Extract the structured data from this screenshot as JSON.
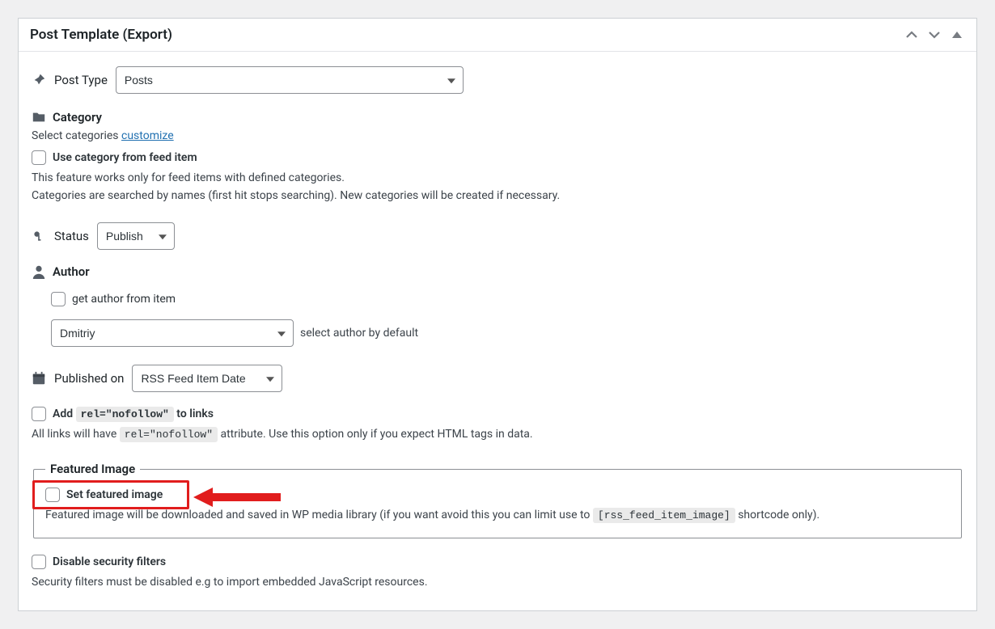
{
  "panel": {
    "title": "Post Template (Export)"
  },
  "post_type": {
    "label": "Post Type",
    "value": "Posts"
  },
  "category": {
    "heading": "Category",
    "prefix": "Select categories ",
    "customize_link": "customize",
    "use_from_feed_label": "Use category from feed item",
    "help1": "This feature works only for feed items with defined categories.",
    "help2": "Categories are searched by names (first hit stops searching). New categories will be created if necessary."
  },
  "status": {
    "label": "Status",
    "value": "Publish"
  },
  "author": {
    "heading": "Author",
    "get_from_item_label": "get author from item",
    "value": "Dmitriy",
    "select_default_label": "select author by default"
  },
  "published_on": {
    "label": "Published on",
    "value": "RSS Feed Item Date"
  },
  "nofollow": {
    "prefix": "Add ",
    "code": "rel=\"nofollow\"",
    "suffix": " to links",
    "help_prefix": "All links will have ",
    "help_suffix": " attribute. Use this option only if you expect HTML tags in data."
  },
  "featured": {
    "legend": "Featured Image",
    "set_label": "Set featured image",
    "help_prefix": "Featured image will be downloaded and saved in WP media library (if you want avoid this you can limit use to ",
    "code": "[rss_feed_item_image]",
    "help_suffix": " shortcode only)."
  },
  "security": {
    "label": "Disable security filters",
    "help": "Security filters must be disabled e.g to import embedded JavaScript resources."
  }
}
